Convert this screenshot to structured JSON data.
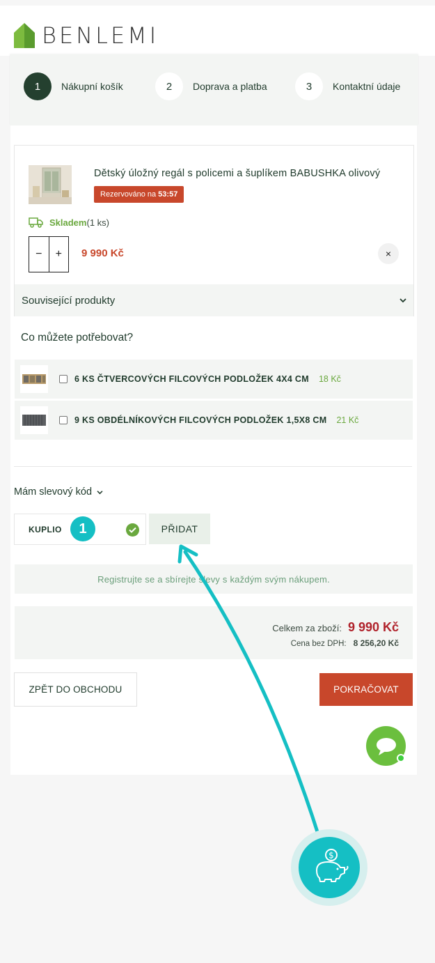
{
  "brand": {
    "name": "BENLEMI"
  },
  "steps": [
    {
      "num": "1",
      "label": "Nákupní košík"
    },
    {
      "num": "2",
      "label": "Doprava a platba"
    },
    {
      "num": "3",
      "label": "Kontaktní údaje"
    }
  ],
  "cart": {
    "product_title": "Dětský úložný regál s policemi a šuplíkem BABUSHKA olivový",
    "reserved_label": "Rezervováno na",
    "reserved_time": "53:57",
    "stock_status": "Skladem",
    "stock_qty": "(1 ks)",
    "minus": "−",
    "plus": "+",
    "price": "9 990 Kč",
    "remove": "×",
    "related_label": "Související produkty"
  },
  "accessories": {
    "title": "Co můžete potřebovat?",
    "items": [
      {
        "name": "6 KS ČTVERCOVÝCH FILCOVÝCH PODLOŽEK 4X4 CM",
        "price": "18 Kč"
      },
      {
        "name": "9 KS OBDÉLNÍKOVÝCH FILCOVÝCH PODLOŽEK 1,5X8 CM",
        "price": "21 Kč"
      }
    ]
  },
  "discount": {
    "toggle_label": "Mám slevový kód",
    "code_value": "KUPLIO",
    "badge": "1",
    "add_label": "PŘIDAT"
  },
  "register_text": "Registrujte se a sbírejte slevy s každým svým nákupem.",
  "totals": {
    "total_label": "Celkem za zboží:",
    "total_value": "9 990 Kč",
    "novat_label": "Cena bez DPH:",
    "novat_value": "8 256,20 Kč"
  },
  "actions": {
    "back_label": "ZPĚT DO OBCHODU",
    "continue_label": "POKRAČOVAT"
  },
  "colors": {
    "accent": "#c8472b",
    "dark_green": "#24402f",
    "green": "#6aa83e",
    "teal": "#15bfc4"
  }
}
